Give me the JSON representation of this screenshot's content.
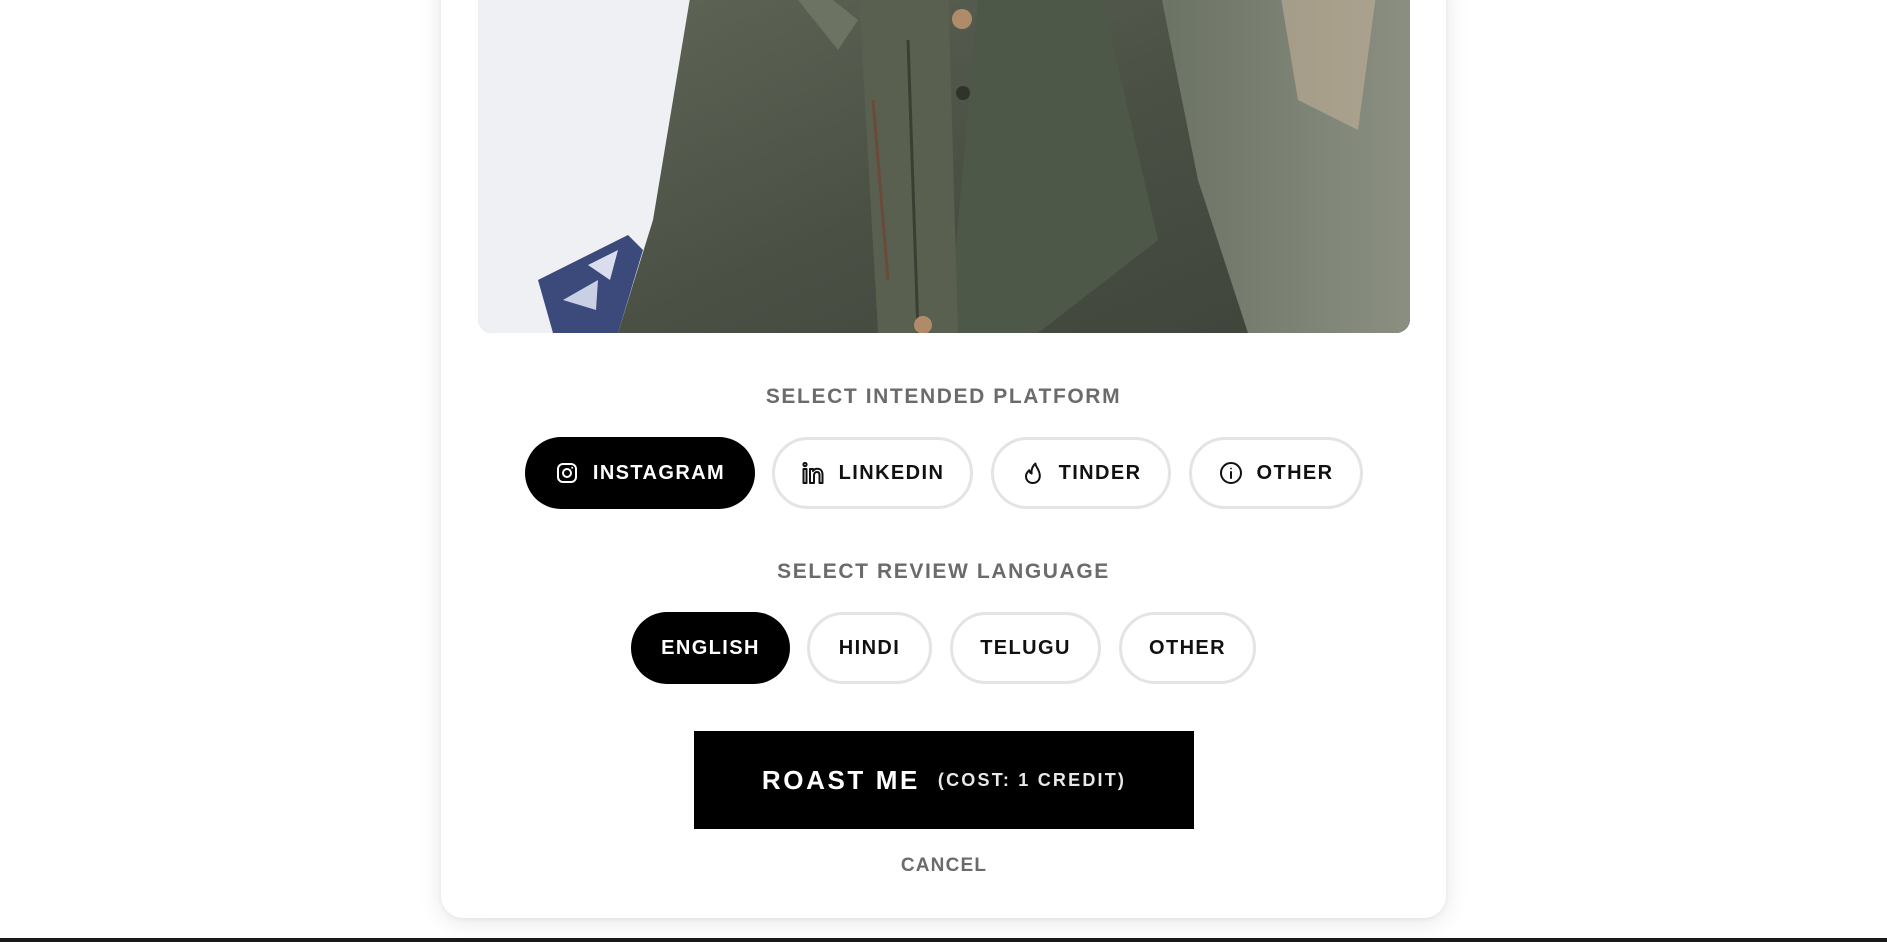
{
  "platform": {
    "label": "SELECT INTENDED PLATFORM",
    "options": [
      {
        "label": "INSTAGRAM",
        "icon": "instagram-icon",
        "selected": true
      },
      {
        "label": "LINKEDIN",
        "icon": "linkedin-icon",
        "selected": false
      },
      {
        "label": "TINDER",
        "icon": "flame-icon",
        "selected": false
      },
      {
        "label": "OTHER",
        "icon": "info-icon",
        "selected": false
      }
    ]
  },
  "language": {
    "label": "SELECT REVIEW LANGUAGE",
    "options": [
      {
        "label": "ENGLISH",
        "selected": true
      },
      {
        "label": "HINDI",
        "selected": false
      },
      {
        "label": "TELUGU",
        "selected": false
      },
      {
        "label": "OTHER",
        "selected": false
      }
    ]
  },
  "actions": {
    "roast_label": "ROAST ME",
    "roast_cost": "(COST: 1 CREDIT)",
    "cancel_label": "CANCEL"
  },
  "colors": {
    "accent": "#000000",
    "label_gray": "#6b6b6b",
    "chip_border": "#e4e4e4"
  }
}
